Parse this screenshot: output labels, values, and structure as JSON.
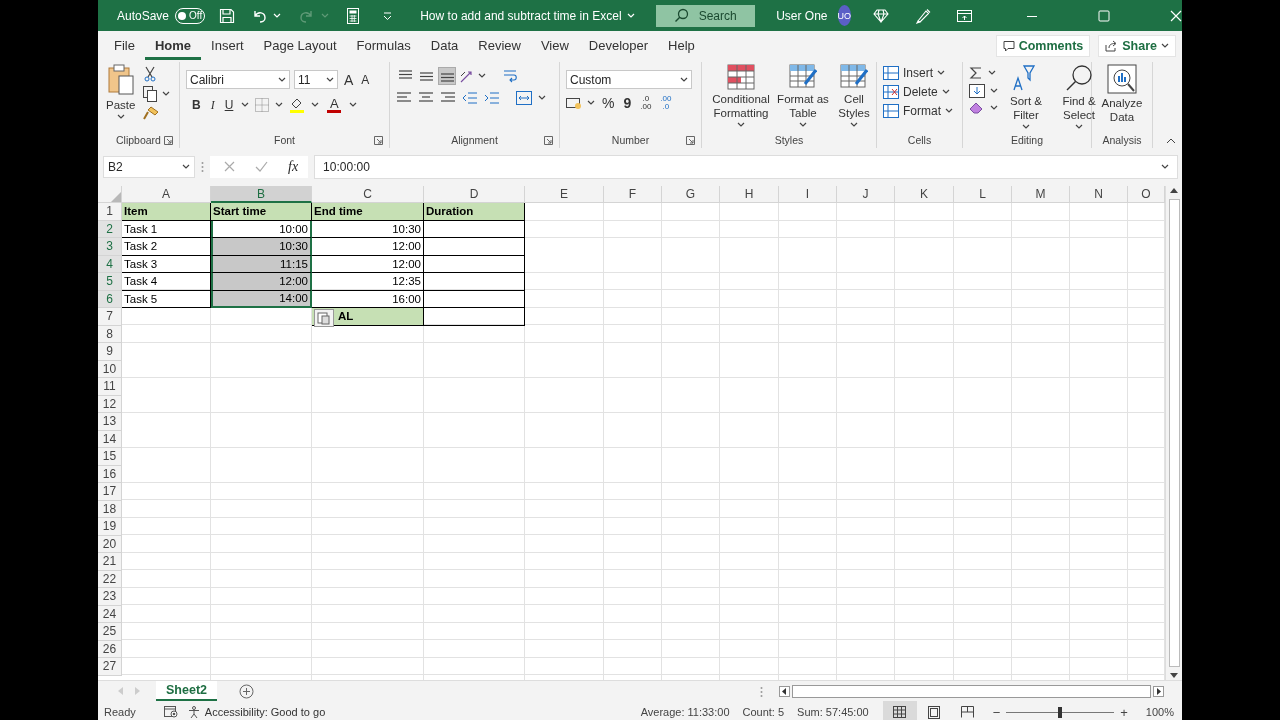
{
  "title_bar": {
    "autosave_label": "AutoSave",
    "autosave": {
      "label": "Off",
      "on": false
    },
    "document_title": "How to add and subtract time in Excel",
    "search": {
      "placeholder": "Search"
    },
    "user_name": "User One",
    "avatar_initials": "UO"
  },
  "menu_tabs": [
    {
      "label": "File",
      "selected": false
    },
    {
      "label": "Home",
      "selected": true
    },
    {
      "label": "Insert",
      "selected": false
    },
    {
      "label": "Page Layout",
      "selected": false
    },
    {
      "label": "Formulas",
      "selected": false
    },
    {
      "label": "Data",
      "selected": false
    },
    {
      "label": "Review",
      "selected": false
    },
    {
      "label": "View",
      "selected": false
    },
    {
      "label": "Developer",
      "selected": false
    },
    {
      "label": "Help",
      "selected": false
    }
  ],
  "comments_button": "Comments",
  "share_button": "Share",
  "ribbon": {
    "clipboard": {
      "label": "Clipboard",
      "paste": "Paste"
    },
    "font": {
      "label": "Font",
      "font_name": "Calibri",
      "font_size": "11",
      "grow": "A",
      "shrink": "A",
      "bold": "B",
      "italic": "I",
      "underline": "U",
      "font_color": "A"
    },
    "alignment": {
      "label": "Alignment",
      "vertical": [
        {
          "selected": false
        },
        {
          "selected": false
        },
        {
          "selected": true
        }
      ]
    },
    "number": {
      "label": "Number",
      "format": "Custom",
      "percent": "%",
      "comma": "9",
      "increase_decimal": [
        ".0",
        ".00"
      ],
      "decrease_decimal": [
        ".00",
        ".0"
      ]
    },
    "styles": {
      "label": "Styles",
      "commands": [
        "Conditional Formatting",
        "Format as Table",
        "Cell Styles"
      ]
    },
    "cells": {
      "label": "Cells",
      "commands": [
        "Insert",
        "Delete",
        "Format"
      ]
    },
    "editing": {
      "label": "Editing",
      "commands": [
        "Sort & Filter",
        "Find & Select"
      ]
    },
    "analysis": {
      "label": "Analysis",
      "command": "Analyze Data"
    }
  },
  "formula_bar": {
    "name_box": "B2",
    "function_button": "fx",
    "formula": "10:00:00"
  },
  "sheet": {
    "columns": [
      {
        "label": "A",
        "selected": false
      },
      {
        "label": "B",
        "selected": true
      },
      {
        "label": "C",
        "selected": false
      },
      {
        "label": "D",
        "selected": false
      },
      {
        "label": "E",
        "selected": false
      },
      {
        "label": "F",
        "selected": false
      },
      {
        "label": "G",
        "selected": false
      },
      {
        "label": "H",
        "selected": false
      },
      {
        "label": "I",
        "selected": false
      },
      {
        "label": "J",
        "selected": false
      },
      {
        "label": "K",
        "selected": false
      },
      {
        "label": "L",
        "selected": false
      },
      {
        "label": "M",
        "selected": false
      },
      {
        "label": "N",
        "selected": false
      },
      {
        "label": "O",
        "selected": false
      }
    ],
    "rows": [
      {
        "number": "1",
        "selected": false,
        "cells": [
          {
            "kind": "heading",
            "text": "Item",
            "selected": false
          },
          {
            "kind": "heading",
            "text": "Start time",
            "selected": false
          },
          {
            "kind": "heading",
            "text": "End time",
            "selected": false
          },
          {
            "kind": "heading",
            "text": "Duration",
            "selected": false
          }
        ]
      },
      {
        "number": "2",
        "selected": true,
        "cells": [
          {
            "kind": "label",
            "text": "Task 1",
            "selected": false
          },
          {
            "kind": "time",
            "text": "10:00",
            "selected": true
          },
          {
            "kind": "time",
            "text": "10:30",
            "selected": false
          },
          {
            "kind": "label",
            "selected": false
          }
        ]
      },
      {
        "number": "3",
        "selected": true,
        "cells": [
          {
            "kind": "label",
            "text": "Task 2",
            "selected": false
          },
          {
            "kind": "time",
            "text": "10:30",
            "selected": true
          },
          {
            "kind": "time",
            "text": "12:00",
            "selected": false
          },
          {
            "kind": "label",
            "selected": false
          }
        ]
      },
      {
        "number": "4",
        "selected": true,
        "cells": [
          {
            "kind": "label",
            "text": "Task 3",
            "selected": false
          },
          {
            "kind": "time",
            "text": "11:15",
            "selected": true
          },
          {
            "kind": "time",
            "text": "12:00",
            "selected": false
          },
          {
            "kind": "label",
            "selected": false
          }
        ]
      },
      {
        "number": "5",
        "selected": true,
        "cells": [
          {
            "kind": "label",
            "text": "Task 4",
            "selected": false
          },
          {
            "kind": "time",
            "text": "12:00",
            "selected": true
          },
          {
            "kind": "time",
            "text": "12:35",
            "selected": false
          },
          {
            "kind": "label",
            "selected": false
          }
        ]
      },
      {
        "number": "6",
        "selected": true,
        "cells": [
          {
            "kind": "label",
            "text": "Task 5",
            "selected": false
          },
          {
            "kind": "time",
            "text": "14:00",
            "selected": true
          },
          {
            "kind": "time",
            "text": "16:00",
            "selected": false
          },
          {
            "kind": "label",
            "selected": false
          }
        ]
      },
      {
        "number": "7",
        "selected": false,
        "cells": [
          {
            "kind": "empty",
            "selected": false
          },
          {
            "kind": "empty",
            "selected": false
          },
          {
            "kind": "total",
            "text": "AL",
            "selected": false
          },
          {
            "kind": "label",
            "selected": false
          }
        ]
      },
      {
        "number": "8",
        "selected": false
      },
      {
        "number": "9",
        "selected": false
      },
      {
        "number": "10",
        "selected": false
      },
      {
        "number": "11",
        "selected": false
      },
      {
        "number": "12",
        "selected": false
      },
      {
        "number": "13",
        "selected": false
      },
      {
        "number": "14",
        "selected": false
      },
      {
        "number": "15",
        "selected": false
      },
      {
        "number": "16",
        "selected": false
      },
      {
        "number": "17",
        "selected": false
      },
      {
        "number": "18",
        "selected": false
      },
      {
        "number": "19",
        "selected": false
      },
      {
        "number": "20",
        "selected": false
      },
      {
        "number": "21",
        "selected": false
      },
      {
        "number": "22",
        "selected": false
      },
      {
        "number": "23",
        "selected": false
      },
      {
        "number": "24",
        "selected": false
      },
      {
        "number": "25",
        "selected": false
      },
      {
        "number": "26",
        "selected": false
      },
      {
        "number": "27",
        "selected": false
      }
    ]
  },
  "sheet_tabs": [
    {
      "label": "Sheet2",
      "selected": true
    }
  ],
  "status_bar": {
    "mode": "Ready",
    "accessibility": "Accessibility: Good to go",
    "average": "Average: 11:33:00",
    "count": "Count: 5",
    "sum": "Sum: 57:45:00",
    "views": [
      {
        "kind": "normal",
        "selected": true
      },
      {
        "kind": "page_layout",
        "selected": false
      },
      {
        "kind": "page_break",
        "selected": false
      }
    ],
    "zoom": {
      "minus": "−",
      "plus": "+",
      "level": 0.5,
      "percent": "100%"
    }
  }
}
